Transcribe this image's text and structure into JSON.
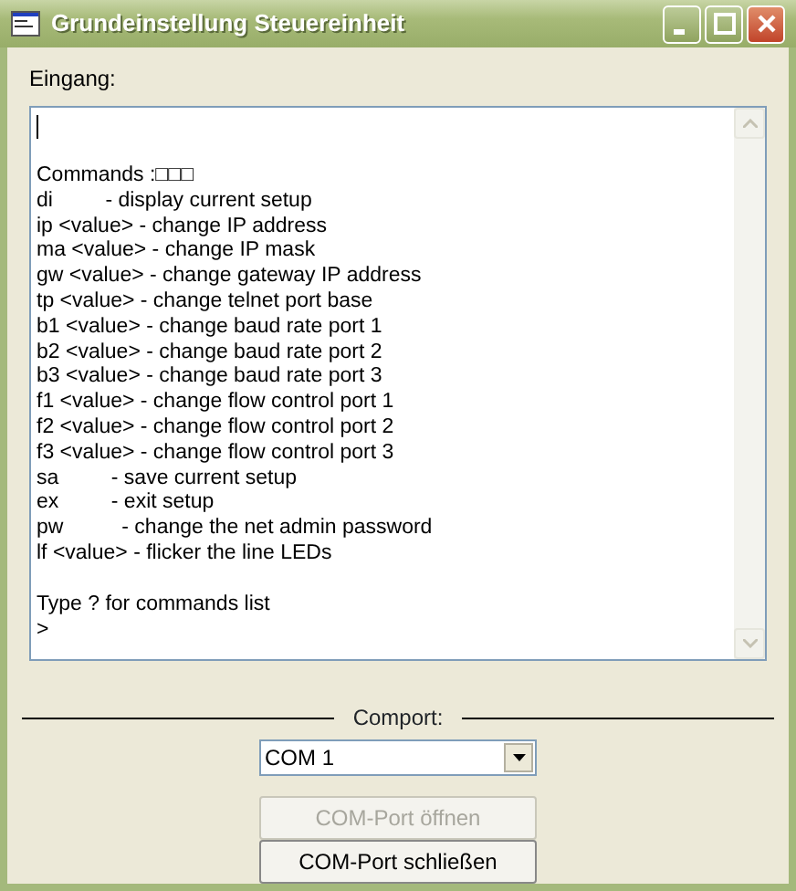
{
  "window": {
    "title": "Grundeinstellung Steuereinheit"
  },
  "input_label": "Eingang:",
  "console": {
    "blocks": [
      [
        "Commands :□□□",
        "di         - display current setup",
        "ip <value> - change IP address",
        "ma <value> - change IP mask",
        "gw <value> - change gateway IP address",
        "tp <value> - change telnet port base",
        "b1 <value> - change baud rate port 1",
        "b2 <value> - change baud rate port 2",
        "b3 <value> - change baud rate port 3",
        "f1 <value> - change flow control port 1",
        "f2 <value> - change flow control port 2",
        "f3 <value> - change flow control port 3",
        "sa         - save current setup",
        "ex         - exit setup",
        "pw          - change the net admin password",
        "lf <value> - flicker the line LEDs"
      ],
      [
        "Type ? for commands list",
        ">"
      ]
    ]
  },
  "comport": {
    "label": "Comport:",
    "value": "COM 1"
  },
  "buttons": [
    {
      "label": "COM-Port öffnen",
      "disabled": true
    },
    {
      "label": "COM-Port schließen",
      "disabled": false
    }
  ]
}
